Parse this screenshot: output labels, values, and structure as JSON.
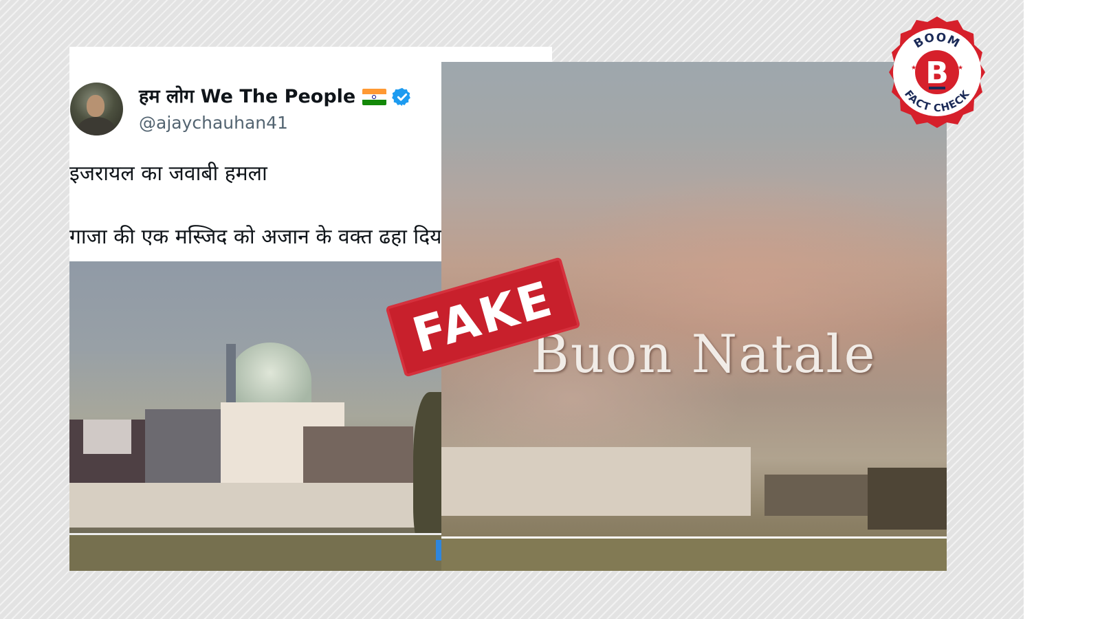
{
  "tweet": {
    "display_name": "हम लोग We The People",
    "flag_icon": "india-flag-icon",
    "verified_icon": "verified-badge-icon",
    "handle": "@ajaychauhan41",
    "text_line_1": "इजरायल का जवाबी हमला",
    "text_line_2": "गाजा की एक मस्जिद को अजान के वक्त ढहा दिया गया"
  },
  "video_overlay_caption": "Buon Natale",
  "stamp": {
    "label": "FAKE",
    "color": "#c8202c"
  },
  "badge": {
    "top_text": "BOOM",
    "letter": "B",
    "bottom_text": "FACT CHECK",
    "color": "#d6202b"
  },
  "colors": {
    "name_text": "#0f1419",
    "handle_text": "#536471",
    "verified_blue": "#1d9bf0"
  }
}
